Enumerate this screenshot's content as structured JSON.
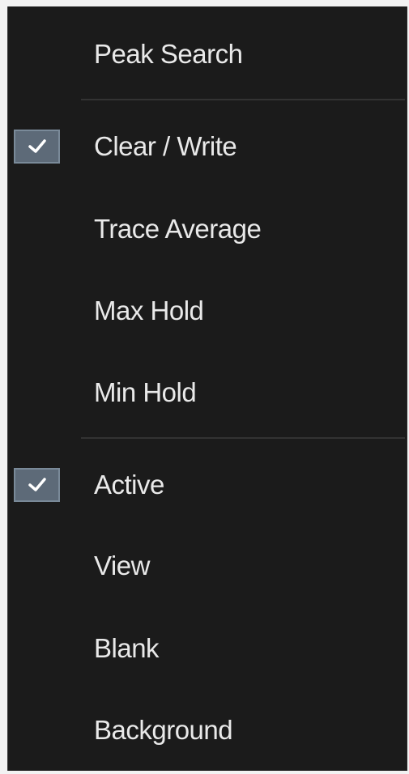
{
  "menu": {
    "items": [
      {
        "label": "Peak Search",
        "checked": false
      },
      {
        "label": "Clear / Write",
        "checked": true
      },
      {
        "label": "Trace Average",
        "checked": false
      },
      {
        "label": "Max Hold",
        "checked": false
      },
      {
        "label": "Min Hold",
        "checked": false
      },
      {
        "label": "Active",
        "checked": true
      },
      {
        "label": "View",
        "checked": false
      },
      {
        "label": "Blank",
        "checked": false
      },
      {
        "label": "Background",
        "checked": false
      }
    ]
  },
  "colors": {
    "background": "#1b1b1b",
    "text": "#e9e9e9",
    "checkbox_fill": "#5d6a78",
    "separator": "#333333"
  },
  "icons": {
    "check": "checkmark-icon"
  }
}
